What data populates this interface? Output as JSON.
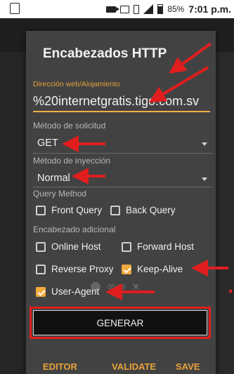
{
  "status_bar": {
    "battery": "85%",
    "time": "7:01 p.m."
  },
  "dialog": {
    "title": "Encabezados HTTP",
    "host_label": "Dirección web/Alojamiento",
    "host_value": "%20internetgratis.tigo.com.sv",
    "method_label": "Método de solicitud",
    "method_value": "GET",
    "injection_label": "Método de inyección",
    "injection_value": "Normal",
    "query_method_label": "Query Method",
    "front_query": "Front Query",
    "back_query": "Back Query",
    "extra_header_label": "Encabezado adicional",
    "online_host": "Online Host",
    "forward_host": "Forward Host",
    "reverse_proxy": "Reverse Proxy",
    "keep_alive": "Keep-Alive",
    "user_agent": "User-Agent",
    "checked": {
      "front_query": false,
      "back_query": false,
      "online_host": false,
      "forward_host": false,
      "reverse_proxy": false,
      "keep_alive": true,
      "user_agent": true
    },
    "generate_button": "GENERAR",
    "footer": {
      "editor": "EDITOR",
      "validate": "VALIDATE",
      "save": "SAVE"
    },
    "media_time": "00:43"
  },
  "colors": {
    "accent": "#f0a93b",
    "annotation": "#e01e1e",
    "dialog_bg": "#424242"
  }
}
